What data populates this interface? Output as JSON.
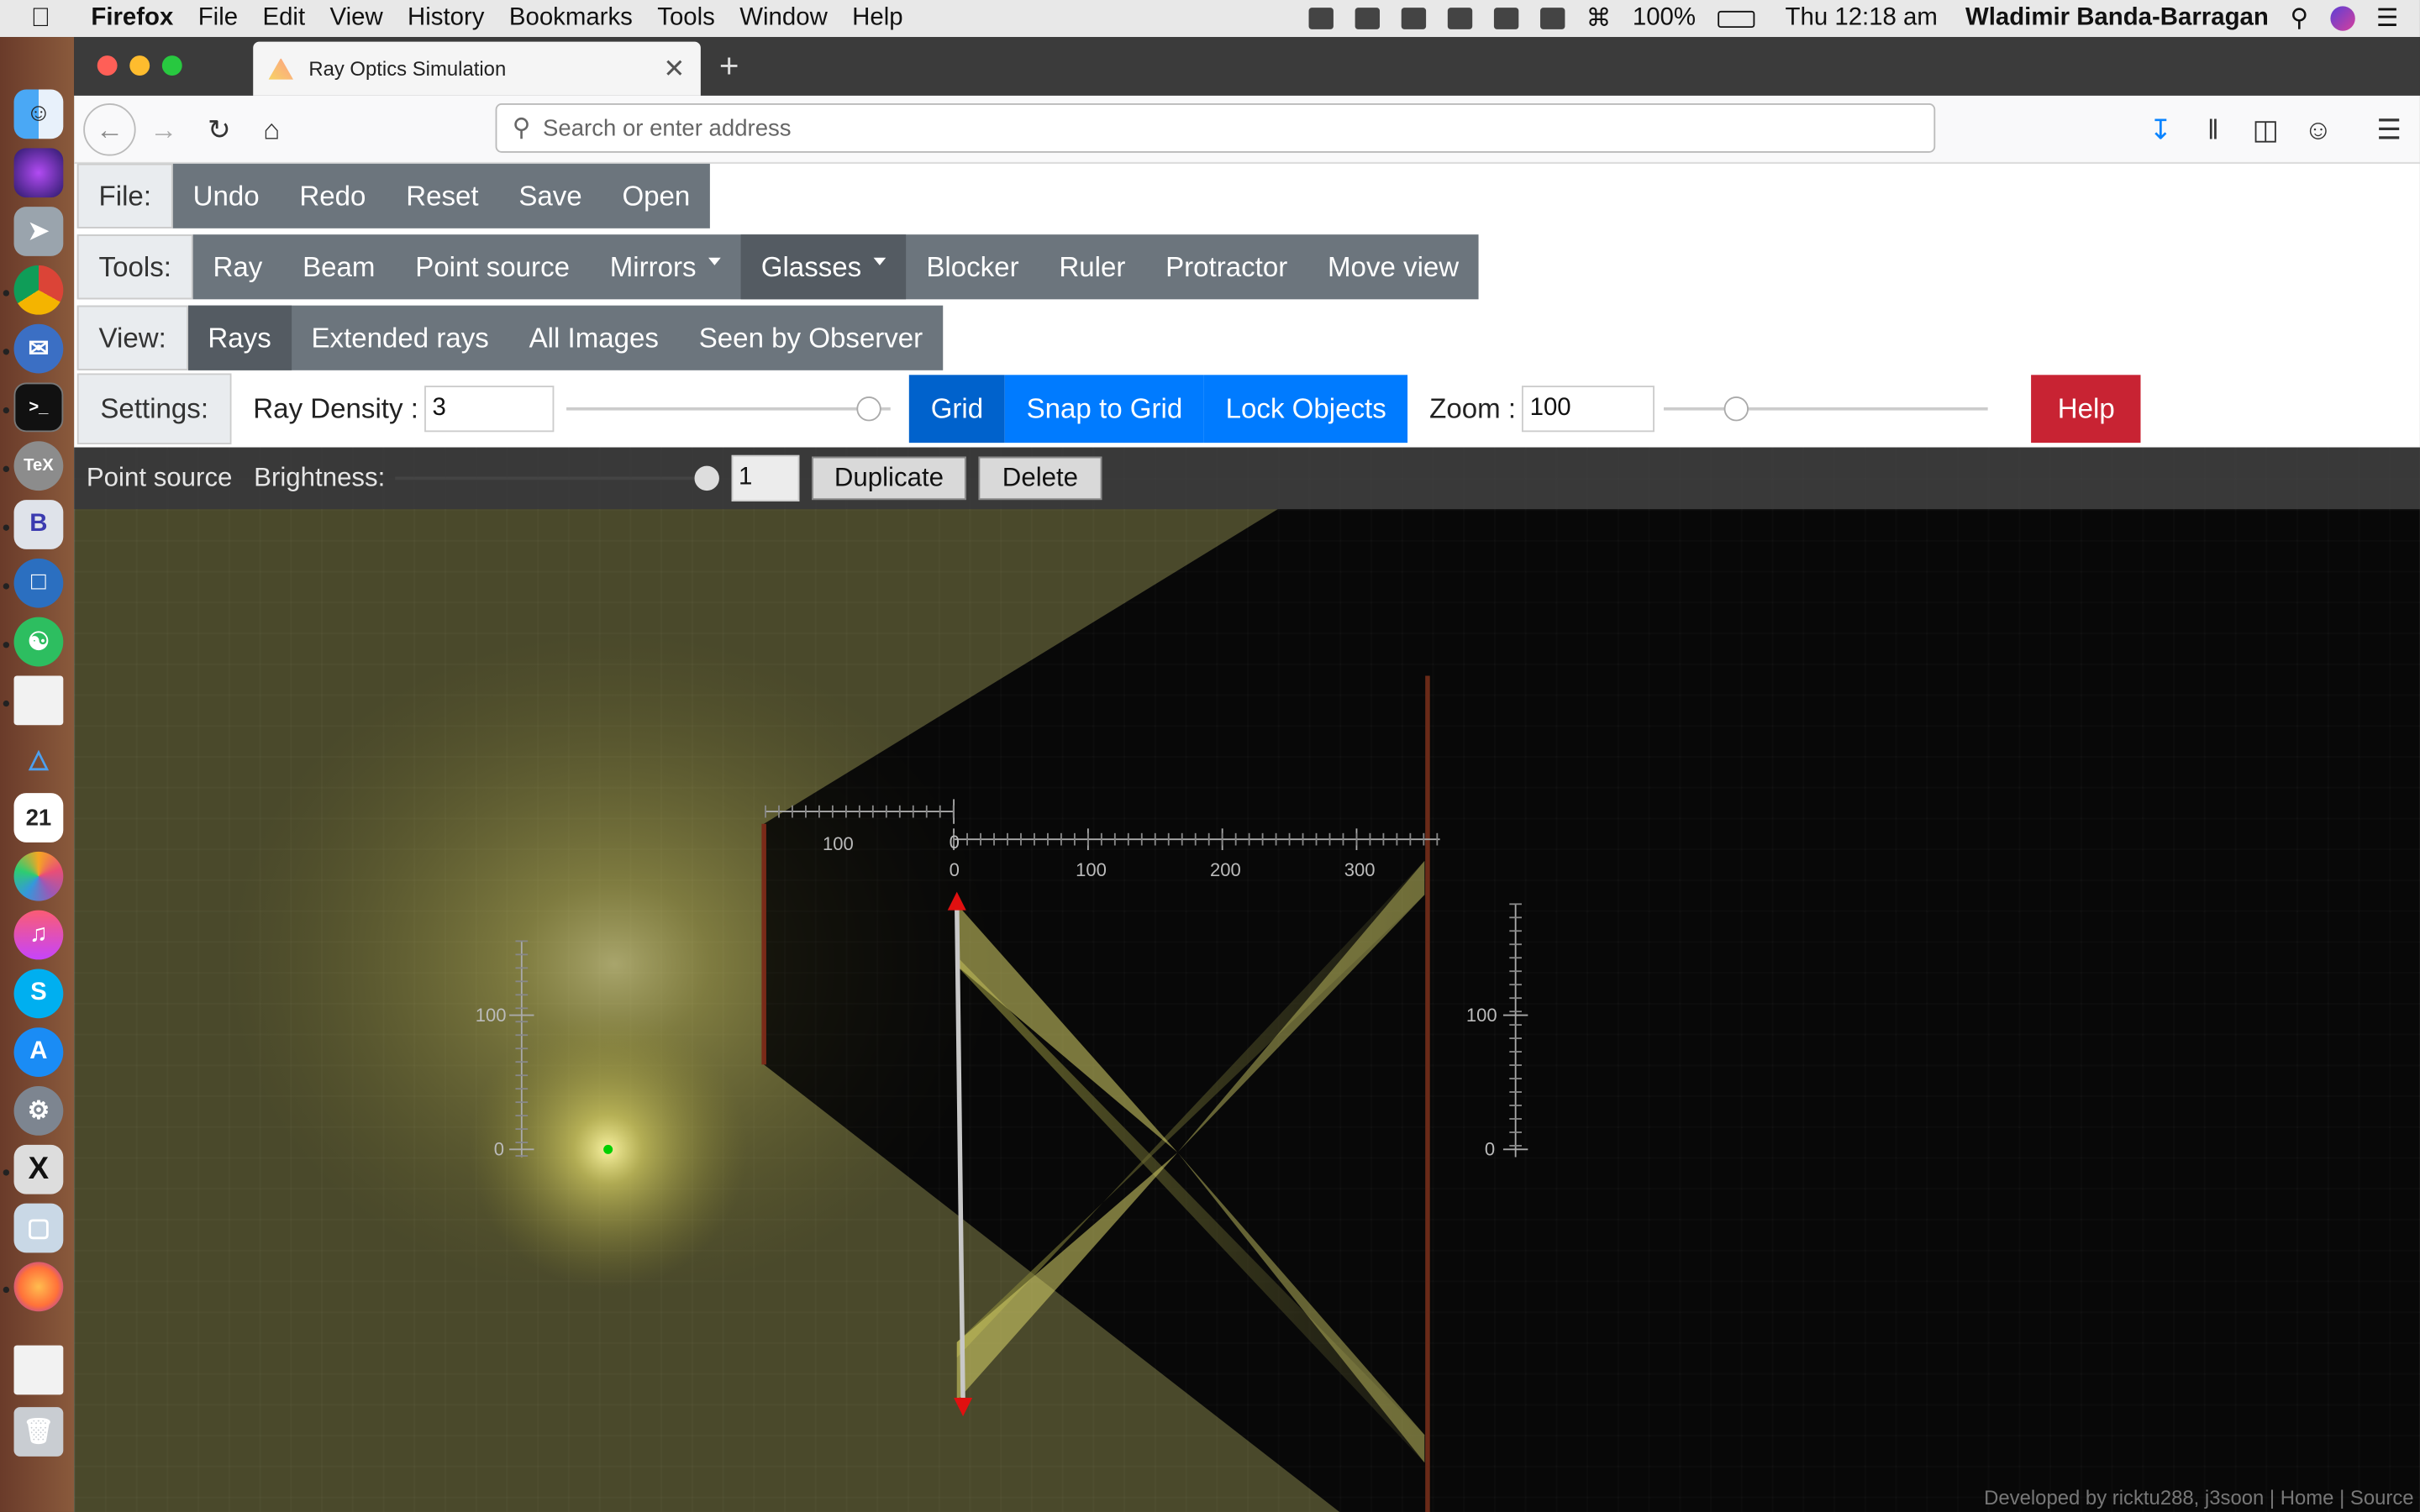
{
  "menubar": {
    "app": "Firefox",
    "items": [
      "File",
      "Edit",
      "View",
      "History",
      "Bookmarks",
      "Tools",
      "Window",
      "Help"
    ],
    "battery": "100%",
    "clock": "Thu 12:18 am",
    "user": "Wladimir Banda-Barragan"
  },
  "browser": {
    "tab_title": "Ray Optics Simulation",
    "url_placeholder": "Search or enter address"
  },
  "file_row": {
    "label": "File:",
    "buttons": [
      "Undo",
      "Redo",
      "Reset",
      "Save",
      "Open"
    ]
  },
  "tools_row": {
    "label": "Tools:",
    "buttons": [
      "Ray",
      "Beam",
      "Point source",
      "Mirrors",
      "Glasses",
      "Blocker",
      "Ruler",
      "Protractor",
      "Move view"
    ],
    "active": "Glasses"
  },
  "view_row": {
    "label": "View:",
    "buttons": [
      "Rays",
      "Extended rays",
      "All Images",
      "Seen by Observer"
    ],
    "active": "Rays"
  },
  "settings": {
    "label": "Settings:",
    "ray_density_label": "Ray Density :",
    "ray_density_value": "3",
    "ray_density_fraction": 0.97,
    "grid": "Grid",
    "snap": "Snap to Grid",
    "lock": "Lock Objects",
    "zoom_label": "Zoom :",
    "zoom_value": "100",
    "zoom_fraction": 0.2,
    "help": "Help"
  },
  "objbar": {
    "name": "Point source",
    "brightness_label": "Brightness:",
    "brightness_value": "1",
    "brightness_fraction": 1.0,
    "duplicate": "Duplicate",
    "delete": "Delete"
  },
  "rulers": {
    "top_left": "100",
    "top_labels": [
      "0",
      "100",
      "200",
      "300"
    ],
    "top_zero": "0",
    "left_labels": [
      "100",
      "0"
    ],
    "right_labels": [
      "100",
      "0"
    ]
  },
  "credit": "Developed by ricktu288, j3soon | Home | Source",
  "colors": {
    "grid_active": "#007bff",
    "help": "#c82333",
    "toolbar": "#6c757d",
    "light": "#f5f08a"
  }
}
